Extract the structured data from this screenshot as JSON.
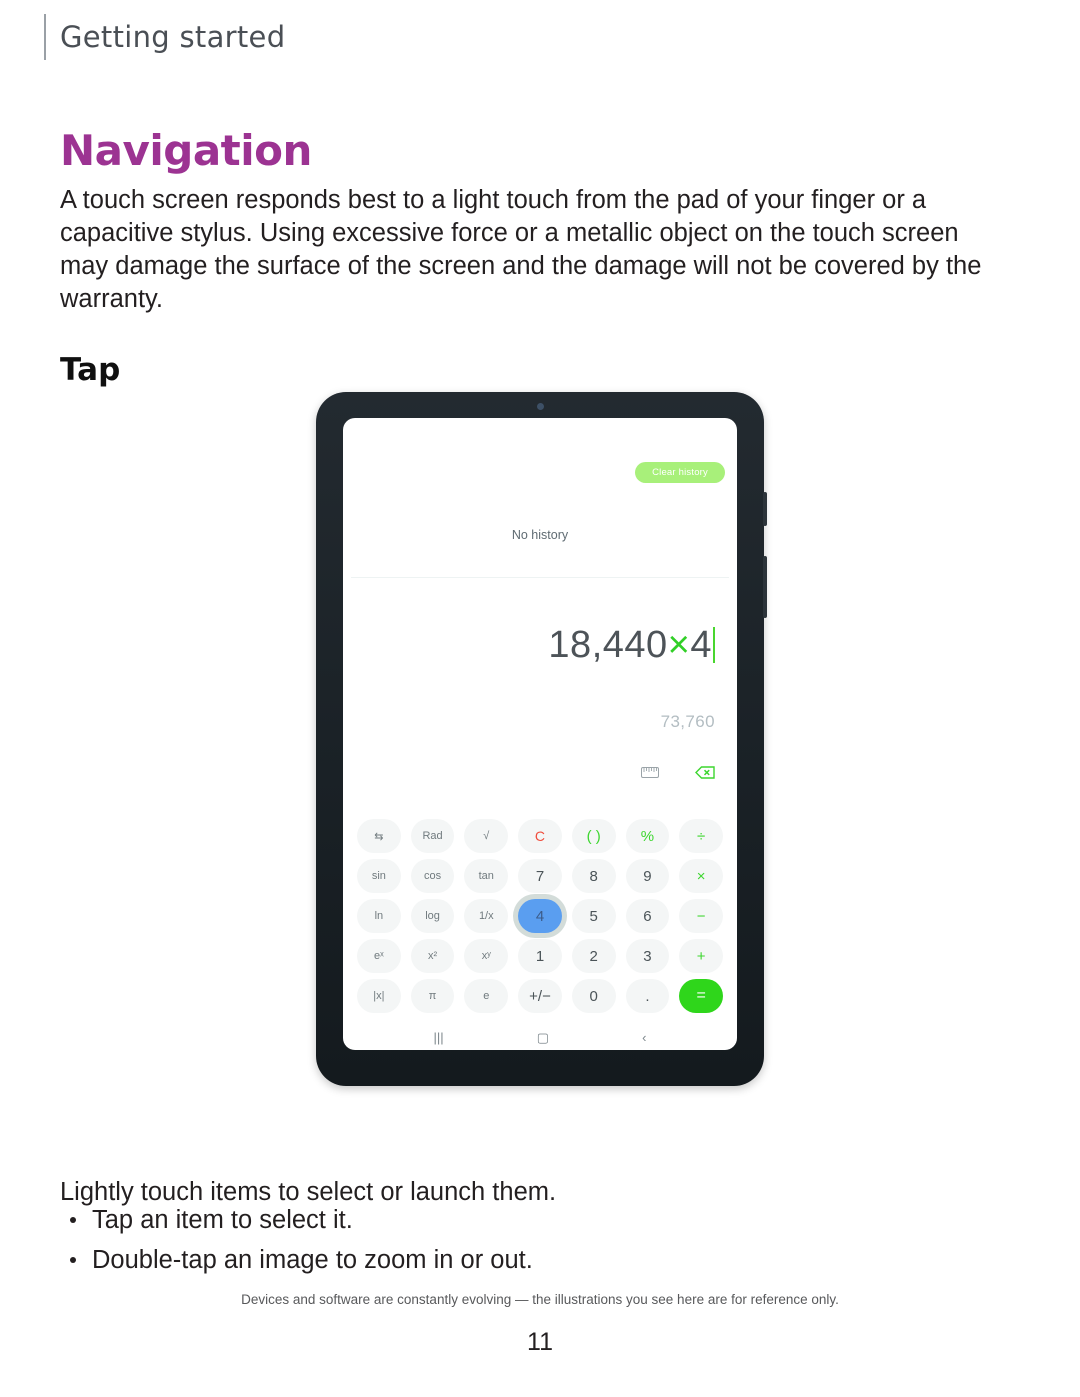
{
  "header": {
    "breadcrumb": "Getting started"
  },
  "section": {
    "title": "Navigation",
    "intro": "A touch screen responds best to a light touch from the pad of your finger or a capacitive stylus. Using excessive force or a metallic object on the touch screen may damage the surface of the screen and the damage will not be covered by the warranty.",
    "sub_heading": "Tap"
  },
  "illustration": {
    "device": "samsung-galaxy-tab",
    "app": "calculator",
    "history": {
      "clear_button_label": "Clear history",
      "empty_label": "No history"
    },
    "display": {
      "expression_prefix": "18,440",
      "expression_operator": "×",
      "expression_suffix": "4",
      "expression_full": "18,440×4",
      "result": "73,760",
      "ruler_icon": "ruler-icon",
      "backspace_icon": "backspace-icon"
    },
    "keypad": {
      "rows": [
        [
          {
            "label": "⇆",
            "kind": "func",
            "name": "degree-radian-swap"
          },
          {
            "label": "Rad",
            "kind": "func",
            "name": "rad"
          },
          {
            "label": "√",
            "kind": "func",
            "name": "square-root"
          },
          {
            "label": "C",
            "kind": "clear",
            "name": "clear"
          },
          {
            "label": "( )",
            "kind": "op",
            "name": "parentheses"
          },
          {
            "label": "%",
            "kind": "op",
            "name": "percent"
          },
          {
            "label": "÷",
            "kind": "op",
            "name": "divide"
          }
        ],
        [
          {
            "label": "sin",
            "kind": "func",
            "name": "sin"
          },
          {
            "label": "cos",
            "kind": "func",
            "name": "cos"
          },
          {
            "label": "tan",
            "kind": "func",
            "name": "tan"
          },
          {
            "label": "7",
            "kind": "digit",
            "name": "seven"
          },
          {
            "label": "8",
            "kind": "digit",
            "name": "eight"
          },
          {
            "label": "9",
            "kind": "digit",
            "name": "nine"
          },
          {
            "label": "×",
            "kind": "op",
            "name": "multiply"
          }
        ],
        [
          {
            "label": "ln",
            "kind": "func",
            "name": "natural-log"
          },
          {
            "label": "log",
            "kind": "func",
            "name": "log"
          },
          {
            "label": "1/x",
            "kind": "func",
            "name": "reciprocal"
          },
          {
            "label": "4",
            "kind": "digit",
            "name": "four",
            "pressed": true
          },
          {
            "label": "5",
            "kind": "digit",
            "name": "five"
          },
          {
            "label": "6",
            "kind": "digit",
            "name": "six"
          },
          {
            "label": "−",
            "kind": "op",
            "name": "minus"
          }
        ],
        [
          {
            "label": "eˣ",
            "kind": "func",
            "name": "e-power-x"
          },
          {
            "label": "x²",
            "kind": "func",
            "name": "x-squared"
          },
          {
            "label": "xʸ",
            "kind": "func",
            "name": "x-power-y"
          },
          {
            "label": "1",
            "kind": "digit",
            "name": "one"
          },
          {
            "label": "2",
            "kind": "digit",
            "name": "two"
          },
          {
            "label": "3",
            "kind": "digit",
            "name": "three"
          },
          {
            "label": "+",
            "kind": "op",
            "name": "plus"
          }
        ],
        [
          {
            "label": "|x|",
            "kind": "func",
            "name": "absolute-value"
          },
          {
            "label": "π",
            "kind": "func",
            "name": "pi"
          },
          {
            "label": "e",
            "kind": "func",
            "name": "euler-e"
          },
          {
            "label": "+/−",
            "kind": "digit",
            "name": "sign-toggle"
          },
          {
            "label": "0",
            "kind": "digit",
            "name": "zero"
          },
          {
            "label": ".",
            "kind": "digit",
            "name": "decimal-point"
          },
          {
            "label": "=",
            "kind": "equals",
            "name": "equals"
          }
        ]
      ]
    },
    "nav_bar": [
      {
        "glyph": "|||",
        "name": "recents-icon"
      },
      {
        "glyph": "▢",
        "name": "home-icon"
      },
      {
        "glyph": "‹",
        "name": "back-icon"
      }
    ]
  },
  "closing": {
    "lead": "Lightly touch items to select or launch them.",
    "bullets": [
      "Tap an item to select it.",
      "Double-tap an image to zoom in or out."
    ]
  },
  "footer": {
    "note": "Devices and software are constantly evolving — the illustrations you see here are for reference only.",
    "page_number": "11"
  },
  "colors": {
    "accent_purple": "#9c3392",
    "calc_green": "#3dd62f",
    "equals_green": "#2fd61b",
    "clear_red": "#f04e3e",
    "pressed_blue": "#5a9ef0",
    "frame_dark": "#1a2126"
  }
}
